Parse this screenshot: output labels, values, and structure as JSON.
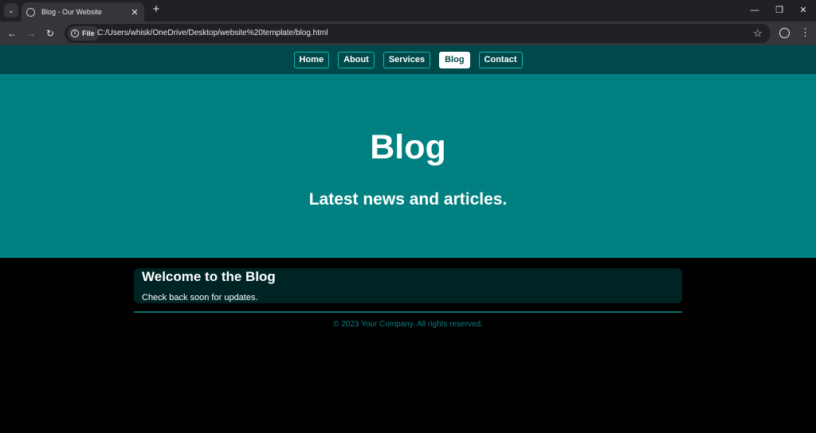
{
  "browser": {
    "tab_title": "Blog - Our Website",
    "url": "C:/Users/whisk/OneDrive/Desktop/website%20template/blog.html",
    "file_label": "File"
  },
  "nav": {
    "items": [
      {
        "label": "Home"
      },
      {
        "label": "About"
      },
      {
        "label": "Services"
      },
      {
        "label": "Blog",
        "active": true
      },
      {
        "label": "Contact"
      }
    ]
  },
  "hero": {
    "title": "Blog",
    "subtitle": "Latest news and articles."
  },
  "post": {
    "title": "Welcome to the Blog",
    "text": "Check back soon for updates."
  },
  "footer": {
    "text": "© 2023 Your Company. All rights reserved."
  },
  "colors": {
    "nav_bg": "#00494a",
    "hero_bg": "#008080",
    "post_bg": "#002424",
    "footer_text": "#0a7f80"
  },
  "icons": [
    "chevron-down-icon",
    "globe-icon",
    "close-icon",
    "plus-icon",
    "minimize-icon",
    "restore-icon",
    "back-icon",
    "forward-icon",
    "reload-icon",
    "info-icon",
    "star-icon",
    "profile-icon",
    "more-vert-icon"
  ]
}
